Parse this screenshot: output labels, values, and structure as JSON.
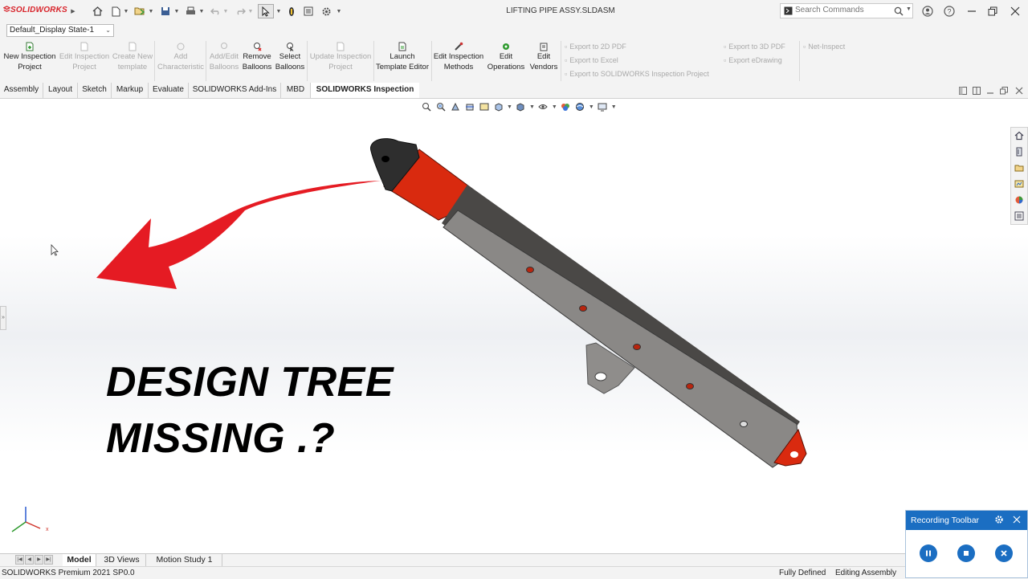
{
  "app": {
    "brand": "SOLIDWORKS",
    "document_title": "LIFTING PIPE ASSY.SLDASM",
    "search_placeholder": "Search Commands"
  },
  "config": {
    "display_state": "Default_Display State-1"
  },
  "ribbon": {
    "buttons": [
      {
        "label1": "New Inspection",
        "label2": "Project",
        "enabled": true
      },
      {
        "label1": "Edit Inspection",
        "label2": "Project",
        "enabled": false
      },
      {
        "label1": "Create New",
        "label2": "template",
        "enabled": false
      },
      {
        "label1": "Add",
        "label2": "Characteristic",
        "enabled": false
      },
      {
        "label1": "Add/Edit",
        "label2": "Balloons",
        "enabled": false
      },
      {
        "label1": "Remove",
        "label2": "Balloons",
        "enabled": true
      },
      {
        "label1": "Select",
        "label2": "Balloons",
        "enabled": true
      },
      {
        "label1": "Update Inspection",
        "label2": "Project",
        "enabled": false
      },
      {
        "label1": "Launch",
        "label2": "Template Editor",
        "enabled": true
      },
      {
        "label1": "Edit Inspection",
        "label2": "Methods",
        "enabled": true
      },
      {
        "label1": "Edit",
        "label2": "Operations",
        "enabled": true
      },
      {
        "label1": "Edit",
        "label2": "Vendors",
        "enabled": true
      }
    ],
    "export_links": [
      {
        "label": "Export to 2D PDF",
        "enabled": false
      },
      {
        "label": "Export to Excel",
        "enabled": false
      },
      {
        "label": "Export to SOLIDWORKS Inspection Project",
        "enabled": false
      },
      {
        "label": "Export to 3D PDF",
        "enabled": false
      },
      {
        "label": "Export eDrawing",
        "enabled": false
      },
      {
        "label": "Net-Inspect",
        "enabled": false
      }
    ]
  },
  "command_tabs": [
    "Assembly",
    "Layout",
    "Sketch",
    "Markup",
    "Evaluate",
    "SOLIDWORKS Add-Ins",
    "MBD",
    "SOLIDWORKS Inspection"
  ],
  "active_command_tab": "SOLIDWORKS Inspection",
  "overlay": {
    "line1": "DESIGN TREE",
    "line2": "MISSING .?",
    "arrow_color": "#e51b23"
  },
  "model": {
    "name": "LIFTING PIPE ASSY",
    "tube_color": "#8a8886",
    "accent_color": "#d92a0f",
    "end_cap_color": "#2e2e2e"
  },
  "bottom_tabs": [
    "Model",
    "3D Views",
    "Motion Study 1"
  ],
  "active_bottom_tab": "Model",
  "status": {
    "version": "SOLIDWORKS Premium 2021 SP0.0",
    "state": "Fully Defined",
    "mode": "Editing Assembly"
  },
  "recording_toolbar": {
    "title": "Recording Toolbar",
    "header_color": "#1b6ec2"
  },
  "icons": [
    "home-icon",
    "new-document-icon",
    "open-icon",
    "save-icon",
    "print-icon",
    "undo-icon",
    "redo-icon",
    "select-icon",
    "rebuild-icon",
    "file-properties-icon",
    "options-icon",
    "search-icon",
    "user-icon",
    "help-icon",
    "minimize-icon",
    "restore-icon",
    "close-icon",
    "pause-icon",
    "stop-icon",
    "cancel-icon",
    "gear-icon"
  ]
}
